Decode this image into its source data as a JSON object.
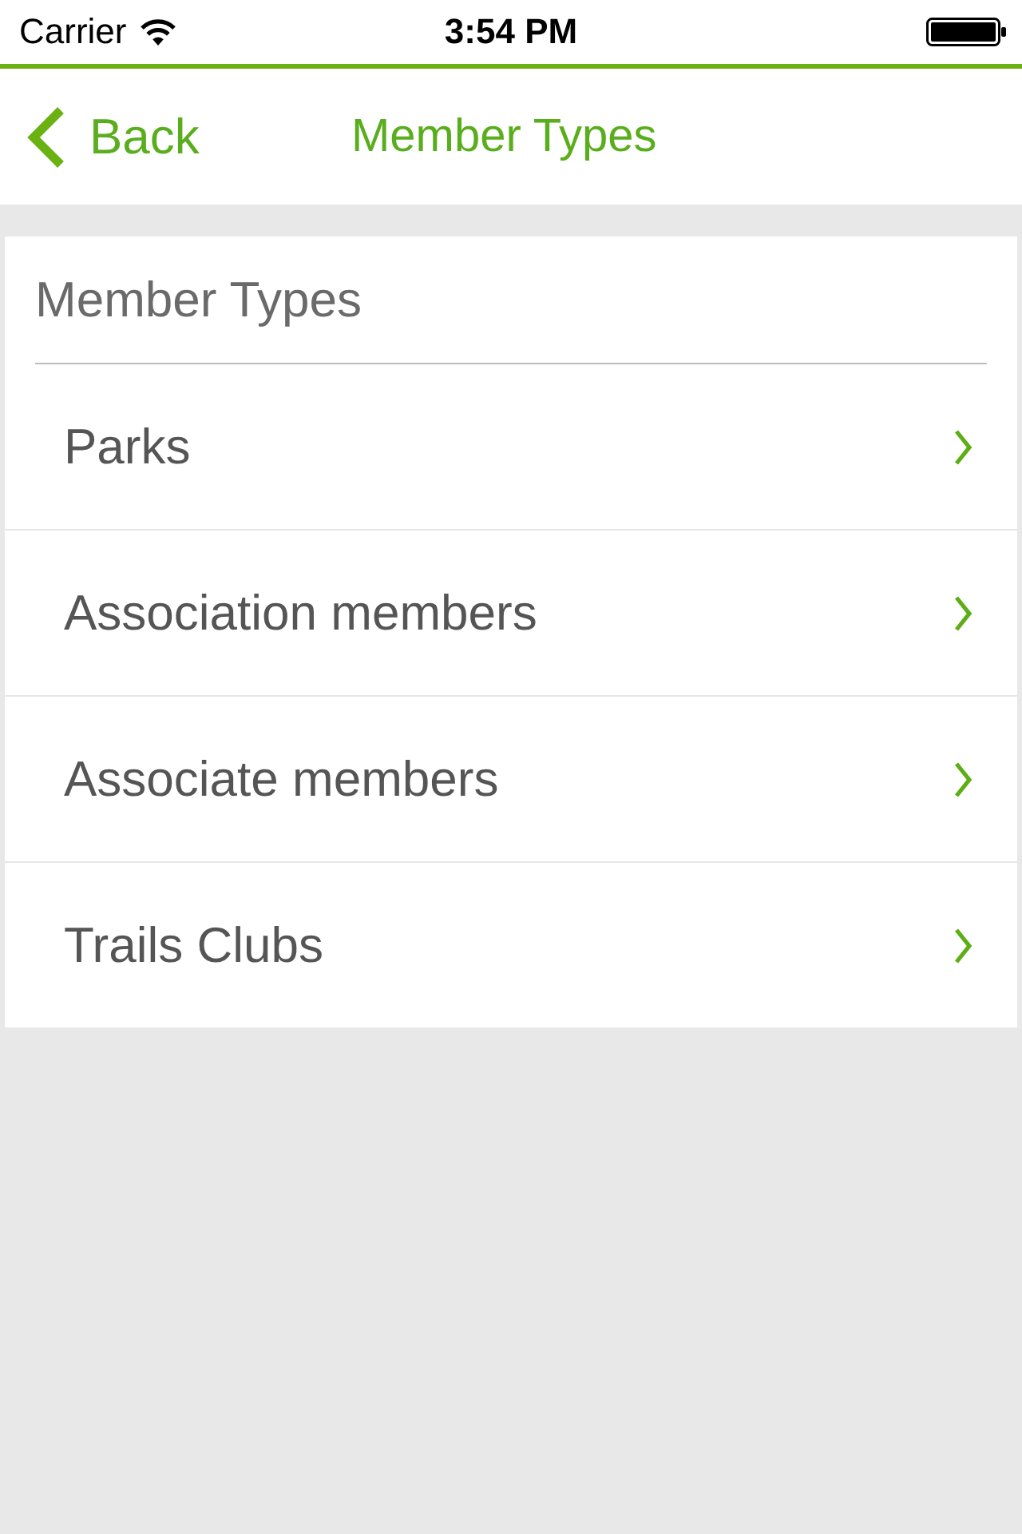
{
  "status_bar": {
    "carrier": "Carrier",
    "time": "3:54 PM"
  },
  "nav_bar": {
    "back_label": "Back",
    "title": "Member Types"
  },
  "list": {
    "header": "Member Types",
    "items": [
      {
        "label": "Parks"
      },
      {
        "label": "Association members"
      },
      {
        "label": "Associate members"
      },
      {
        "label": "Trails Clubs"
      }
    ]
  }
}
